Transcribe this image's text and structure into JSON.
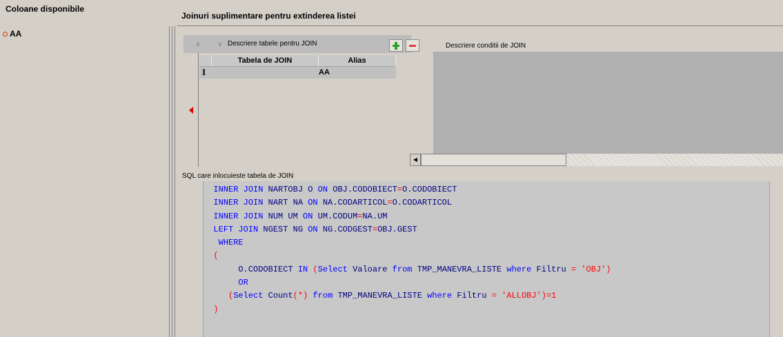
{
  "left": {
    "title": "Coloane disponibile",
    "items": [
      {
        "label": "AA"
      }
    ]
  },
  "right": {
    "title": "Joinuri suplimentare pentru extinderea listei"
  },
  "join_toolbar": {
    "up_icon": "chevron-up-icon",
    "down_icon": "chevron-down-icon",
    "tables_label": "Descriere tabele pentru JOIN",
    "add_icon": "plus-icon",
    "remove_icon": "minus-icon",
    "conditions_label": "Descriere conditii de JOIN"
  },
  "join_grid": {
    "columns": [
      "Tabela de JOIN",
      "Alias"
    ],
    "rows": [
      {
        "cursor": "I",
        "tabela": "",
        "alias": "AA"
      }
    ]
  },
  "sql": {
    "label": "SQL care inlocuieste tabela de JOIN",
    "lines": [
      [
        [
          "kw",
          "INNER JOIN "
        ],
        [
          "tx",
          "NARTOBJ O "
        ],
        [
          "kw",
          "ON "
        ],
        [
          "tx",
          "OBJ.CODOBIECT"
        ],
        [
          "ob",
          "="
        ],
        [
          "tx",
          "O.CODOBIECT"
        ]
      ],
      [
        [
          "kw",
          "INNER JOIN "
        ],
        [
          "tx",
          "NART NA "
        ],
        [
          "kw",
          "ON "
        ],
        [
          "tx",
          "NA.CODARTICOL"
        ],
        [
          "ob",
          "="
        ],
        [
          "tx",
          "O.CODARTICOL"
        ]
      ],
      [
        [
          "kw",
          "INNER JOIN "
        ],
        [
          "tx",
          "NUM UM "
        ],
        [
          "kw",
          "ON "
        ],
        [
          "tx",
          "UM.CODUM"
        ],
        [
          "ob",
          "="
        ],
        [
          "tx",
          "NA.UM"
        ]
      ],
      [
        [
          "kw",
          "LEFT JOIN "
        ],
        [
          "tx",
          "NGEST NG "
        ],
        [
          "kw",
          "ON "
        ],
        [
          "tx",
          "NG.CODGEST"
        ],
        [
          "ob",
          "="
        ],
        [
          "tx",
          "OBJ.GEST"
        ]
      ],
      [
        [
          "kw",
          " WHERE"
        ]
      ],
      [
        [
          "ob",
          "("
        ]
      ],
      [
        [
          "tx",
          "     O.CODOBIECT "
        ],
        [
          "kw",
          "IN "
        ],
        [
          "ob",
          "("
        ],
        [
          "kw",
          "Select "
        ],
        [
          "tx",
          "Valoare "
        ],
        [
          "kw",
          "from "
        ],
        [
          "tx",
          "TMP_MANEVRA_LISTE "
        ],
        [
          "kw",
          "where "
        ],
        [
          "tx",
          "Filtru "
        ],
        [
          "ob",
          "= "
        ],
        [
          "st",
          "'OBJ'"
        ],
        [
          "ob",
          ")"
        ]
      ],
      [
        [
          "kw",
          "     OR"
        ]
      ],
      [
        [
          "tx",
          "   "
        ],
        [
          "ob",
          "("
        ],
        [
          "kw",
          "Select "
        ],
        [
          "tx",
          "Count"
        ],
        [
          "ob",
          "(*) "
        ],
        [
          "kw",
          "from "
        ],
        [
          "tx",
          "TMP_MANEVRA_LISTE "
        ],
        [
          "kw",
          "where "
        ],
        [
          "tx",
          "Filtru "
        ],
        [
          "ob",
          "= "
        ],
        [
          "st",
          "'ALLOBJ'"
        ],
        [
          "ob",
          ")=1"
        ]
      ],
      [
        [
          "ob",
          ")"
        ]
      ]
    ]
  }
}
